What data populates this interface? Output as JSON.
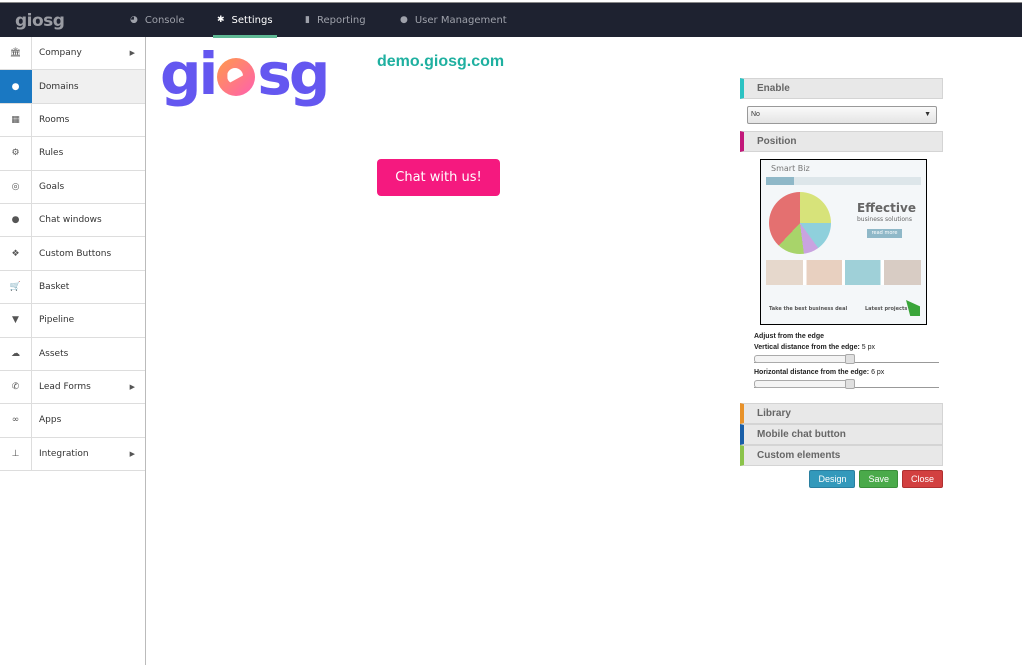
{
  "topbar": {
    "brand": "giosg",
    "nav": [
      {
        "label": "Console",
        "icon": "console-icon"
      },
      {
        "label": "Settings",
        "icon": "gear-icon",
        "active": true
      },
      {
        "label": "Reporting",
        "icon": "bar-chart-icon"
      },
      {
        "label": "User Management",
        "icon": "user-icon"
      }
    ]
  },
  "sidebar": {
    "items": [
      {
        "label": "Company",
        "icon": "bank-icon",
        "submenu": true
      },
      {
        "label": "Domains",
        "icon": "globe-icon",
        "active": true
      },
      {
        "label": "Rooms",
        "icon": "grid-icon"
      },
      {
        "label": "Rules",
        "icon": "gears-icon"
      },
      {
        "label": "Goals",
        "icon": "target-icon"
      },
      {
        "label": "Chat windows",
        "icon": "chat-bubble-icon"
      },
      {
        "label": "Custom Buttons",
        "icon": "cubes-icon"
      },
      {
        "label": "Basket",
        "icon": "cart-icon"
      },
      {
        "label": "Pipeline",
        "icon": "filter-icon"
      },
      {
        "label": "Assets",
        "icon": "cloud-upload-icon"
      },
      {
        "label": "Lead Forms",
        "icon": "phone-icon",
        "submenu": true
      },
      {
        "label": "Apps",
        "icon": "gamepad-icon"
      },
      {
        "label": "Integration",
        "icon": "sitemap-icon",
        "submenu": true
      }
    ]
  },
  "main": {
    "logo": "giosg",
    "domain": "demo.giosg.com",
    "chat_button": "Chat with us!"
  },
  "panel": {
    "enable": {
      "label": "Enable",
      "value": "No"
    },
    "position": {
      "label": "Position"
    },
    "preview": {
      "brand": "Smart Biz",
      "headline": "Effective",
      "subhead": "business solutions",
      "cta": "read more",
      "tagline": "Take the best business deal",
      "projects": "Latest projects"
    },
    "adjust_title": "Adjust from the edge",
    "vertical": {
      "label": "Vertical distance from the edge:",
      "value": "5 px"
    },
    "horizontal": {
      "label": "Horizontal distance from the edge:",
      "value": "6 px"
    },
    "sections": [
      {
        "label": "Library",
        "color": "#e8922a"
      },
      {
        "label": "Mobile chat button",
        "color": "#1a5fa8"
      },
      {
        "label": "Custom elements",
        "color": "#8bc34a"
      }
    ],
    "buttons": {
      "design": "Design",
      "save": "Save",
      "close": "Close"
    }
  },
  "colors": {
    "accent": "#1a78c2",
    "chat_button": "#f5197f",
    "domain_text": "#1fb0a0",
    "enable_bar": "#2cc3c3",
    "position_bar": "#c2187a"
  }
}
